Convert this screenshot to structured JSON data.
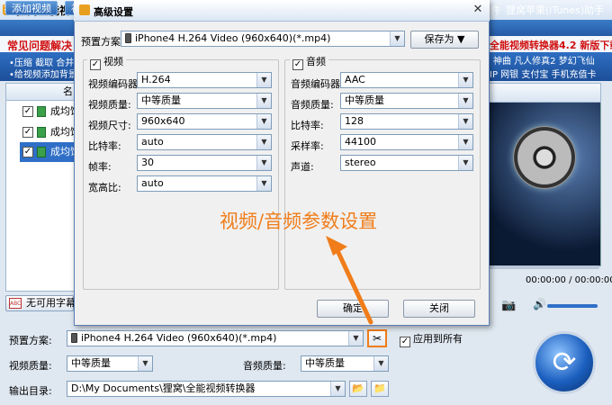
{
  "main": {
    "title": "狸窝全能视",
    "toolbar": {
      "add_video": "添加视频",
      "tab_partial": "视",
      "right_partial": "件",
      "apple_assistant": "狸窝苹果(iTunes)助手"
    },
    "faq": "常见问题解决",
    "promo": "全能视频转换器4.2 新版下载",
    "strip_line1": "•压缩 截取 合并",
    "strip_line2": "•给视频添加背景",
    "links_row1": "神曲  凡人修真2  梦幻飞仙",
    "links_row2": "IP  网银  支付宝  手机充值卡",
    "list_header": "名",
    "list_items": [
      "成均馆",
      "成均馆",
      "成均馆"
    ],
    "subtitle_btn": "无可用字幕",
    "abc": "ABC",
    "time": "00:00:00 / 00:00:00",
    "preset_label": "预置方案:",
    "preset_value": "iPhone4 H.264 Video (960x640)(*.mp4)",
    "apply_all": "应用到所有",
    "video_quality_label": "视频质量:",
    "video_quality_value": "中等质量",
    "audio_quality_label": "音频质量:",
    "audio_quality_value": "中等质量",
    "output_label": "输出目录:",
    "output_value": "D:\\My Documents\\狸窝\\全能视频转换器"
  },
  "dialog": {
    "title": "高级设置",
    "preset_label": "预置方案:",
    "preset_value": "iPhone4 H.264 Video (960x640)(*.mp4)",
    "save_as": "保存为",
    "video_group": "视频",
    "audio_group": "音频",
    "video_fields": [
      {
        "label": "视频编码器:",
        "value": "H.264"
      },
      {
        "label": "视频质量:",
        "value": "中等质量"
      },
      {
        "label": "视频尺寸:",
        "value": "960x640"
      },
      {
        "label": "比特率:",
        "value": "auto"
      },
      {
        "label": "帧率:",
        "value": "30"
      },
      {
        "label": "宽高比:",
        "value": "auto"
      }
    ],
    "audio_fields": [
      {
        "label": "音频编码器:",
        "value": "AAC"
      },
      {
        "label": "音频质量:",
        "value": "中等质量"
      },
      {
        "label": "比特率:",
        "value": "128"
      },
      {
        "label": "采样率:",
        "value": "44100"
      },
      {
        "label": "声道:",
        "value": "stereo"
      }
    ],
    "ok": "确定",
    "close": "关闭"
  },
  "annotation": "视频/音频参数设置",
  "colors": {
    "accent": "#f07d1a",
    "toolbar": "#2f68b3",
    "promo": "#d01010"
  }
}
